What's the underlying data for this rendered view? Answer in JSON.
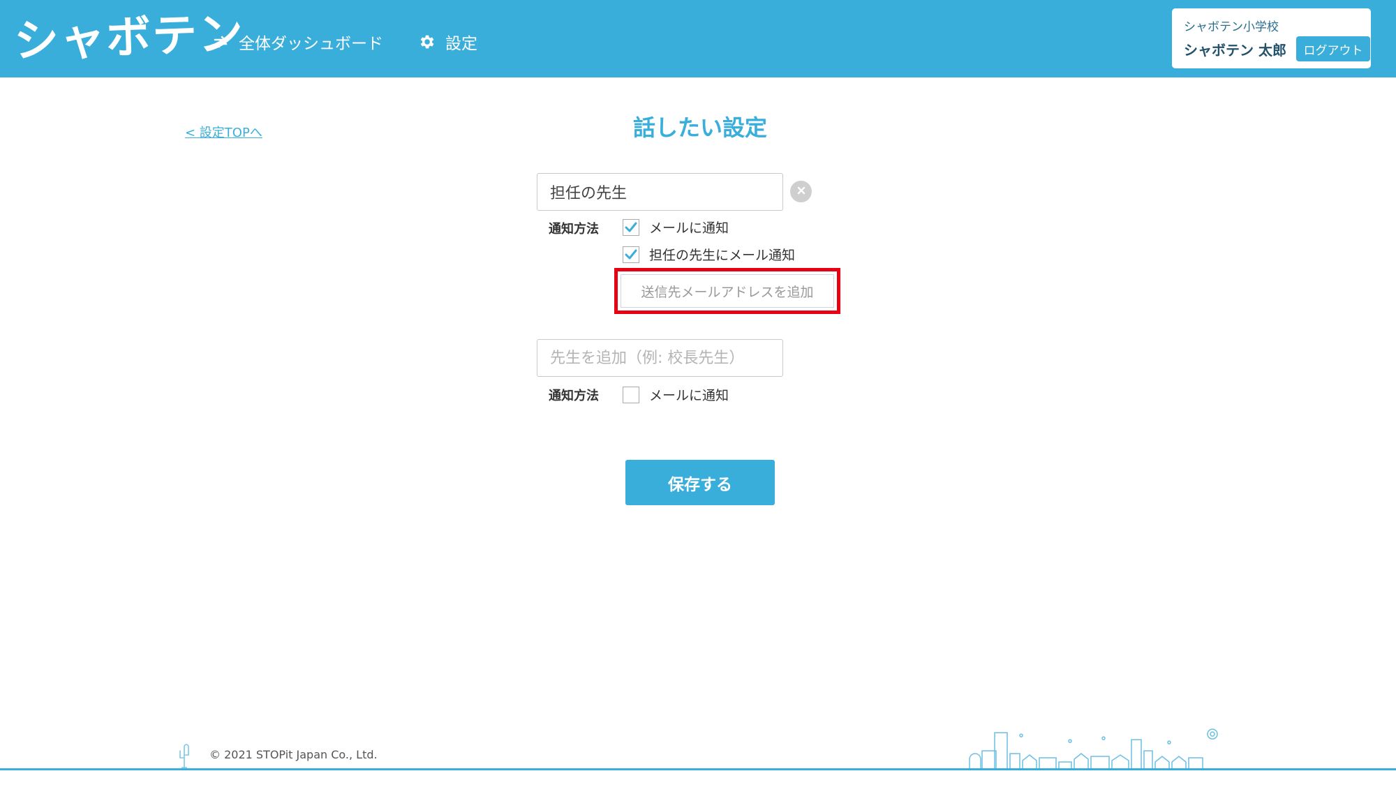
{
  "header": {
    "logo": "シャボテン",
    "nav": [
      {
        "label": "全体ダッシュボード",
        "icon": "sync-arrows-icon"
      },
      {
        "label": "設定",
        "icon": "gear-icon"
      }
    ],
    "user": {
      "school": "シャボテン小学校",
      "name": "シャボテン 太郎",
      "logout_label": "ログアウト"
    }
  },
  "main": {
    "back_link": "< 設定TOPへ",
    "title": "話したい設定",
    "teachers": [
      {
        "name_value": "担任の先生",
        "method_label": "通知方法",
        "options": [
          {
            "label": "メールに通知",
            "checked": true
          },
          {
            "label": "担任の先生にメール通知",
            "checked": true
          }
        ],
        "add_email_label": "送信先メールアドレスを追加"
      },
      {
        "name_placeholder": "先生を追加（例: 校長先生）",
        "method_label": "通知方法",
        "options": [
          {
            "label": "メールに通知",
            "checked": false
          }
        ]
      }
    ],
    "save_label": "保存する"
  },
  "footer": {
    "copyright": "© 2021 STOPit Japan Co., Ltd."
  },
  "colors": {
    "brand": "#3aaedb",
    "highlight": "#e60012",
    "checkmark": "#3aaedb"
  }
}
